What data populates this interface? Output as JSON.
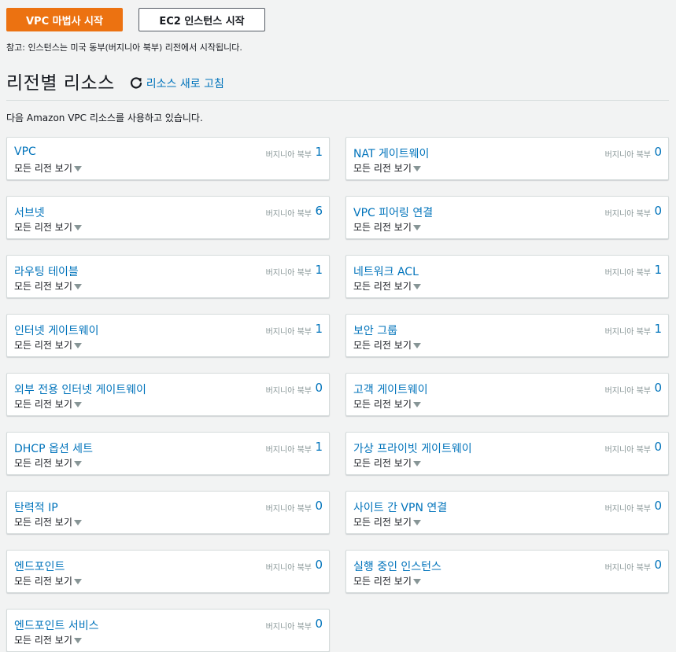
{
  "buttons": {
    "vpc_wizard": "VPC 마법사 시작",
    "ec2_launch": "EC2 인스턴스 시작"
  },
  "note": "참고: 인스턴스는 미국 동부(버지니아 북부) 리전에서 시작됩니다.",
  "heading": "리전별 리소스",
  "refresh_label": "리소스 새로 고침",
  "intro": "다음 Amazon VPC 리소스를 사용하고 있습니다.",
  "colors": {
    "accent": "#ec7211",
    "link": "#0073bb",
    "muted": "#879596"
  },
  "cards": [
    {
      "title": "VPC",
      "sub": "모든 리전 보기",
      "region": "버지니아 북부",
      "count": "1"
    },
    {
      "title": "NAT 게이트웨이",
      "sub": "모든 리전 보기",
      "region": "버지니아 북부",
      "count": "0"
    },
    {
      "title": "서브넷",
      "sub": "모든 리전 보기",
      "region": "버지니아 북부",
      "count": "6"
    },
    {
      "title": "VPC 피어링 연결",
      "sub": "모든 리전 보기",
      "region": "버지니아 북부",
      "count": "0"
    },
    {
      "title": "라우팅 테이블",
      "sub": "모든 리전 보기",
      "region": "버지니아 북부",
      "count": "1"
    },
    {
      "title": "네트워크 ACL",
      "sub": "모든 리전 보기",
      "region": "버지니아 북부",
      "count": "1"
    },
    {
      "title": "인터넷 게이트웨이",
      "sub": "모든 리전 보기",
      "region": "버지니아 북부",
      "count": "1"
    },
    {
      "title": "보안 그룹",
      "sub": "모든 리전 보기",
      "region": "버지니아 북부",
      "count": "1"
    },
    {
      "title": "외부 전용 인터넷 게이트웨이",
      "sub": "모든 리전 보기",
      "region": "버지니아 북부",
      "count": "0"
    },
    {
      "title": "고객 게이트웨이",
      "sub": "모든 리전 보기",
      "region": "버지니아 북부",
      "count": "0"
    },
    {
      "title": "DHCP 옵션 세트",
      "sub": "모든 리전 보기",
      "region": "버지니아 북부",
      "count": "1"
    },
    {
      "title": "가상 프라이빗 게이트웨이",
      "sub": "모든 리전 보기",
      "region": "버지니아 북부",
      "count": "0"
    },
    {
      "title": "탄력적 IP",
      "sub": "모든 리전 보기",
      "region": "버지니아 북부",
      "count": "0"
    },
    {
      "title": "사이트 간 VPN 연결",
      "sub": "모든 리전 보기",
      "region": "버지니아 북부",
      "count": "0"
    },
    {
      "title": "엔드포인트",
      "sub": "모든 리전 보기",
      "region": "버지니아 북부",
      "count": "0"
    },
    {
      "title": "실행 중인 인스턴스",
      "sub": "모든 리전 보기",
      "region": "버지니아 북부",
      "count": "0"
    },
    {
      "title": "엔드포인트 서비스",
      "sub": "모든 리전 보기",
      "region": "버지니아 북부",
      "count": "0"
    }
  ]
}
